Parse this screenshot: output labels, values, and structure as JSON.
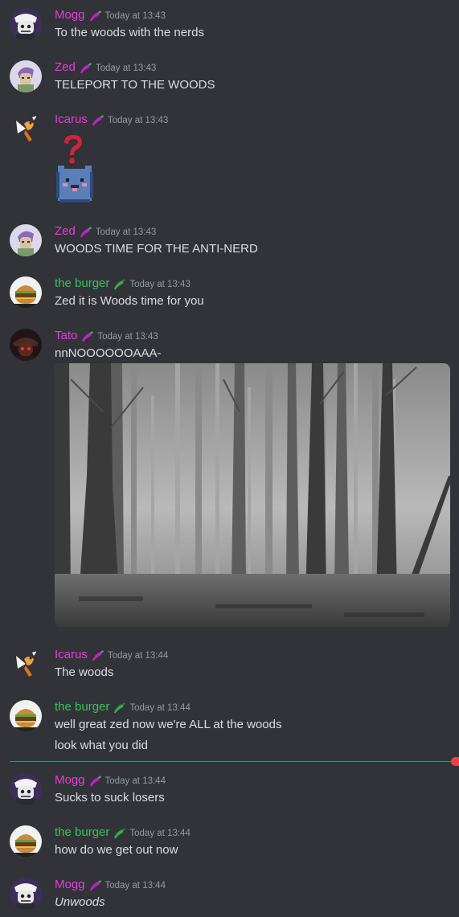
{
  "messages": [
    {
      "user": "Mogg",
      "time": "Today at 13:43",
      "lines": [
        "To the woods with the nerds"
      ]
    },
    {
      "user": "Zed",
      "time": "Today at 13:43",
      "lines": [
        "TELEPORT TO THE WOODS"
      ]
    },
    {
      "user": "Icarus",
      "time": "Today at 13:43",
      "lines": [],
      "emojis": [
        "question-mark-emoji",
        "pixel-creature-emoji"
      ]
    },
    {
      "user": "Zed",
      "time": "Today at 13:43",
      "lines": [
        "WOODS TIME FOR THE ANTI-NERD"
      ]
    },
    {
      "user": "the burger",
      "time": "Today at 13:43",
      "lines": [
        "Zed it is Woods time for you"
      ]
    },
    {
      "user": "Tato",
      "time": "Today at 13:43",
      "lines": [
        "nnNOOOOOOAAA-"
      ],
      "attachment": "foggy-forest-image"
    },
    {
      "user": "Icarus",
      "time": "Today at 13:44",
      "lines": [
        "The woods"
      ]
    },
    {
      "user": "the burger",
      "time": "Today at 13:44",
      "lines": [
        "well great zed now we're ALL at the woods",
        "look what you did"
      ]
    },
    {
      "user": "Mogg",
      "time": "Today at 13:44",
      "lines": [
        "Sucks to suck losers"
      ]
    },
    {
      "user": "the burger",
      "time": "Today at 13:44",
      "lines": [
        "how do we get out now"
      ]
    },
    {
      "user": "Mogg",
      "time": "Today at 13:44",
      "lines": [
        "Unwoods"
      ]
    }
  ],
  "colors": {
    "background": "#313338",
    "pink_name": "#e83cdb",
    "green_name": "#3bc25a",
    "timestamp": "#949ba4",
    "text": "#dbdee1",
    "new_divider": "#f23f43"
  },
  "icons": {
    "role_tag_pink": "chili-pepper-icon",
    "role_tag_green": "chili-pepper-icon"
  }
}
